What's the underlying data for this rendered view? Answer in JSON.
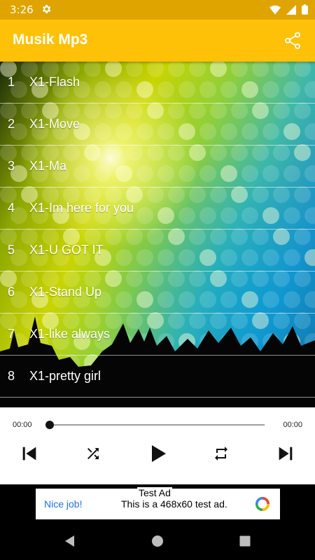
{
  "status_bar": {
    "time": "3:26"
  },
  "app_bar": {
    "title": "Musik Mp3"
  },
  "tracks": [
    {
      "number": "1",
      "title": "X1-Flash"
    },
    {
      "number": "2",
      "title": "X1-Move"
    },
    {
      "number": "3",
      "title": "X1-Ma"
    },
    {
      "number": "4",
      "title": "X1-Im here for you"
    },
    {
      "number": "5",
      "title": "X1-U GOT IT"
    },
    {
      "number": "6",
      "title": "X1-Stand Up"
    },
    {
      "number": "7",
      "title": "X1-like always"
    },
    {
      "number": "8",
      "title": "X1-pretty girl"
    }
  ],
  "player": {
    "current_time": "00:00",
    "duration": "00:00",
    "progress": 0
  },
  "ad": {
    "tag": "Test Ad",
    "headline": "Nice job!",
    "message": "This is a 468x60 test ad."
  },
  "colors": {
    "accent": "#ffc107",
    "status_bar": "#e0a400",
    "ad_link": "#1a73e8"
  },
  "icons": [
    "gear-icon",
    "wifi-icon",
    "signal-icon",
    "battery-icon",
    "share-icon",
    "skip-previous-icon",
    "shuffle-icon",
    "play-icon",
    "repeat-icon",
    "skip-next-icon",
    "back-icon",
    "home-icon",
    "recents-icon"
  ]
}
